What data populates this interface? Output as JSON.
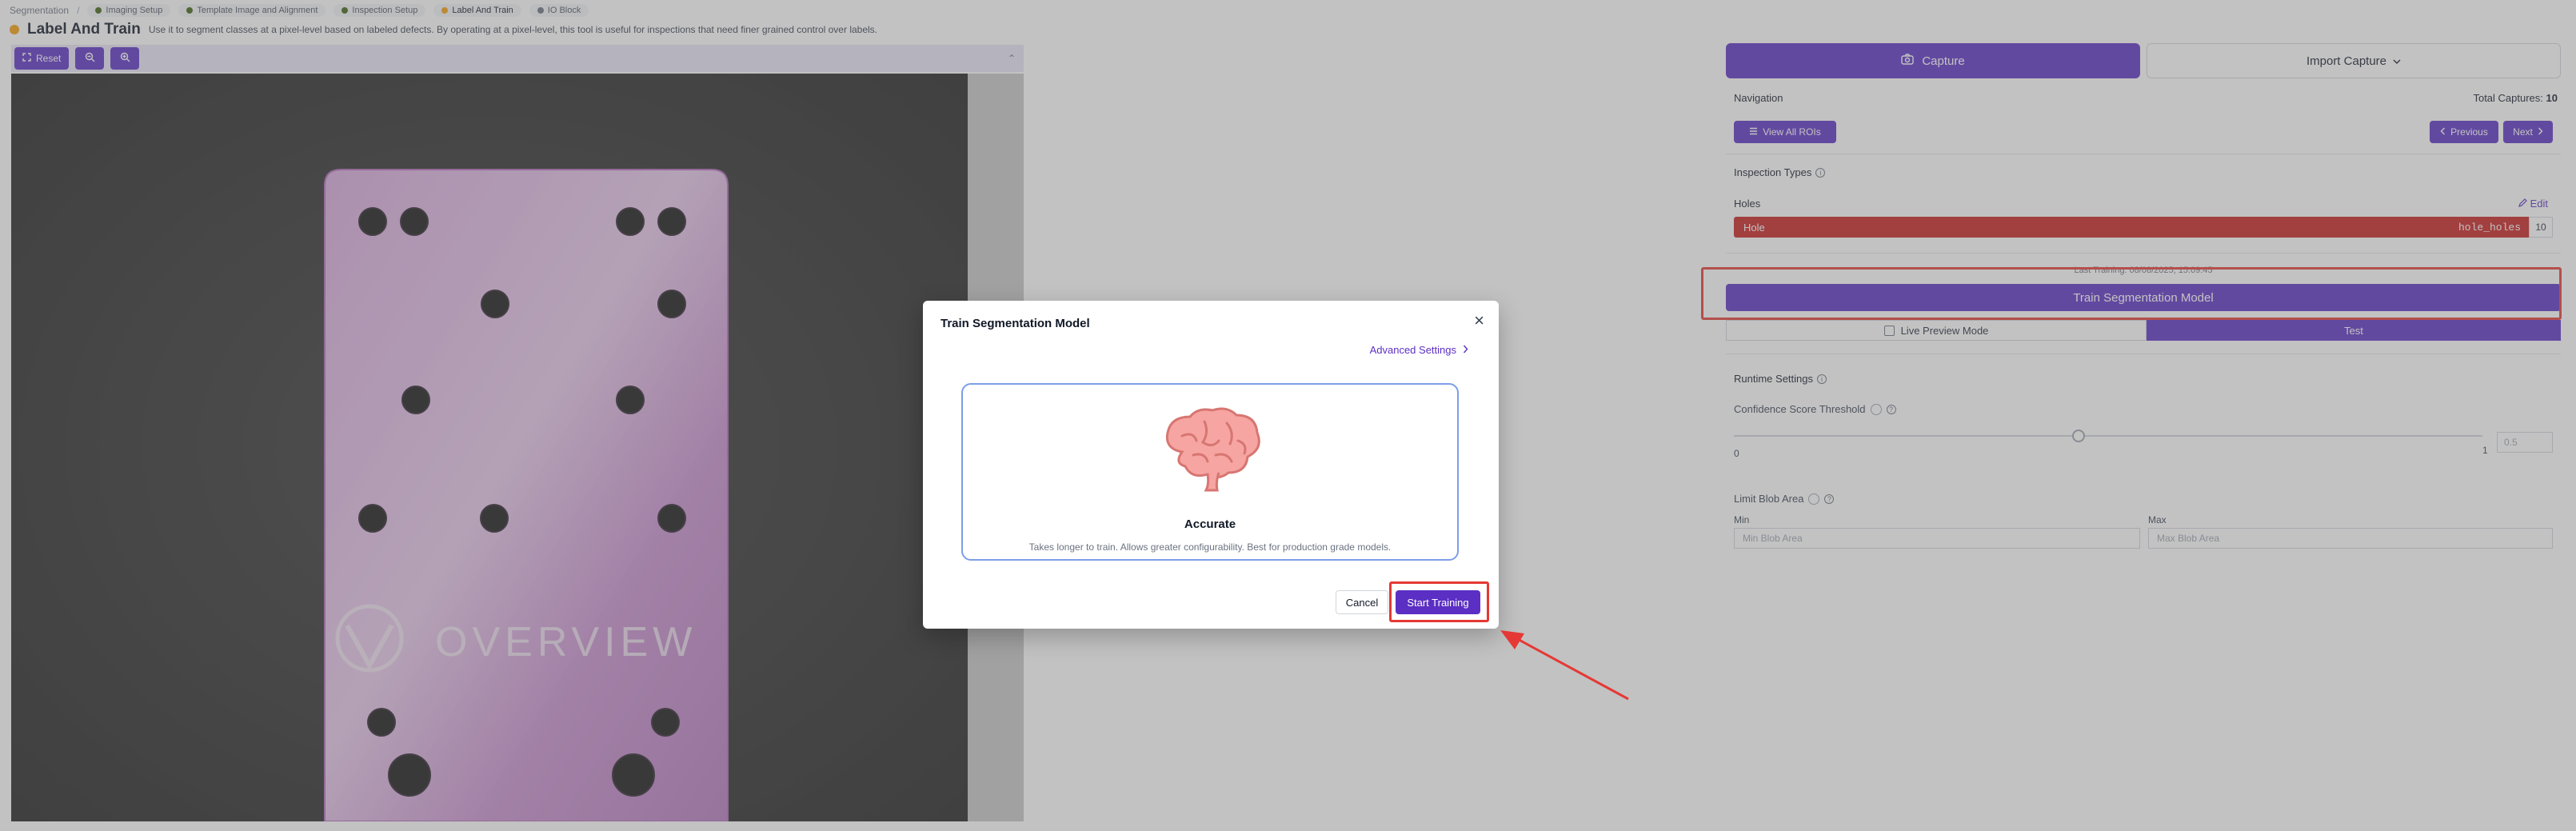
{
  "breadcrumb": {
    "root": "Segmentation",
    "separator": "/",
    "steps": [
      {
        "label": "Imaging Setup",
        "state": "done"
      },
      {
        "label": "Template Image and Alignment",
        "state": "done"
      },
      {
        "label": "Inspection Setup",
        "state": "done"
      },
      {
        "label": "Label And Train",
        "state": "active"
      },
      {
        "label": "IO Block",
        "state": "pending"
      }
    ]
  },
  "header": {
    "title": "Label And Train",
    "description": "Use it to segment classes at a pixel-level based on labeled defects. By operating at a pixel-level, this tool is useful for inspections that need finer grained control over labels."
  },
  "toolbar": {
    "reset_label": "Reset",
    "zoom_out_icon": "zoom-out-icon",
    "zoom_in_icon": "zoom-in-icon",
    "collapse_icon": "chevron-up-icon"
  },
  "image": {
    "logo_text": "OVERVIEW"
  },
  "right_panel": {
    "capture_label": "Capture",
    "import_label": "Import Capture",
    "navigation_label": "Navigation",
    "total_captures_label": "Total Captures:",
    "total_captures_value": "10",
    "view_all_label": "View All ROIs",
    "previous_label": "Previous",
    "next_label": "Next",
    "inspection_types_label": "Inspection Types",
    "holes_label": "Holes",
    "edit_label": "Edit",
    "hole_class_label": "Hole",
    "hole_class_code": "hole_holes",
    "hole_count": "10",
    "last_training": "Last Training: 08/08/2025, 15:09:45",
    "train_label": "Train Segmentation Model",
    "live_preview_label": "Live Preview Mode",
    "test_label": "Test",
    "runtime_settings_label": "Runtime Settings",
    "confidence_label": "Confidence Score Threshold",
    "confidence_value": 0.46,
    "slider_min": "0",
    "slider_max": "1",
    "confidence_input": "0.5",
    "limit_blob_label": "Limit Blob Area",
    "min_label": "Min",
    "max_label": "Max",
    "min_placeholder": "Min Blob Area",
    "max_placeholder": "Max Blob Area"
  },
  "modal": {
    "title": "Train Segmentation Model",
    "advanced_label": "Advanced Settings",
    "card_title": "Accurate",
    "card_desc": "Takes longer to train. Allows greater configurability. Best for production grade models.",
    "cancel_label": "Cancel",
    "start_label": "Start Training"
  },
  "colors": {
    "accent": "#5b2fc4",
    "annotation_red": "#e53935",
    "hole_class": "#c81e1e"
  }
}
